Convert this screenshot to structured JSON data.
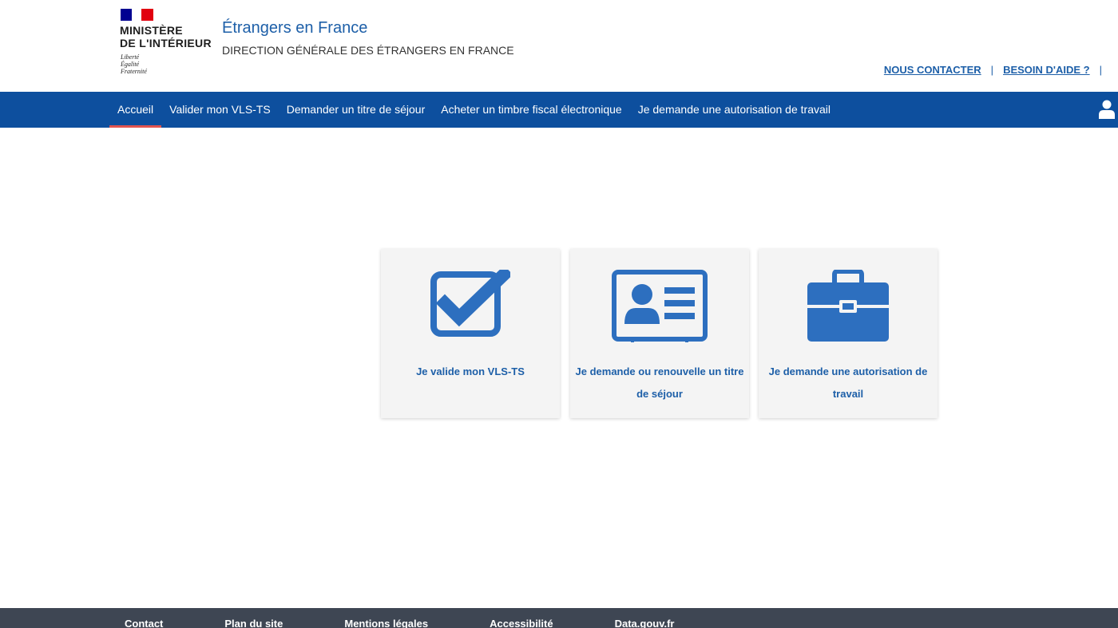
{
  "header": {
    "ministry_line1": "MINISTÈRE",
    "ministry_line2": "DE L'INTÉRIEUR",
    "motto": [
      "Liberté",
      "Égalité",
      "Fraternité"
    ],
    "site_title": "Étrangers en France",
    "site_subtitle": "DIRECTION GÉNÉRALE DES ÉTRANGERS EN FRANCE",
    "links": {
      "contact": "NOUS CONTACTER",
      "help": "BESOIN D'AIDE ?"
    }
  },
  "nav": {
    "items": [
      {
        "label": "Accueil",
        "active": true
      },
      {
        "label": "Valider mon VLS-TS"
      },
      {
        "label": "Demander un titre de séjour"
      },
      {
        "label": "Acheter un timbre fiscal électronique"
      },
      {
        "label": "Je demande une autorisation de travail"
      }
    ],
    "user_icon": "user-icon"
  },
  "cards": [
    {
      "label": "Je valide mon VLS-TS",
      "icon": "checkbox-icon"
    },
    {
      "label": "Je demande ou renouvelle un titre de séjour",
      "icon": "id-card-icon"
    },
    {
      "label": "Je demande une autorisation de travail",
      "icon": "briefcase-icon"
    }
  ],
  "footer": {
    "links": [
      "Contact",
      "Plan du site",
      "Mentions légales",
      "Accessibilité",
      "Data.gouv.fr"
    ]
  },
  "colors": {
    "nav_bg": "#0d4f9e",
    "accent_blue": "#1d5fa8",
    "icon_blue": "#2d6fbf",
    "active_underline": "#e1544f",
    "footer_bg": "#3e4653"
  }
}
